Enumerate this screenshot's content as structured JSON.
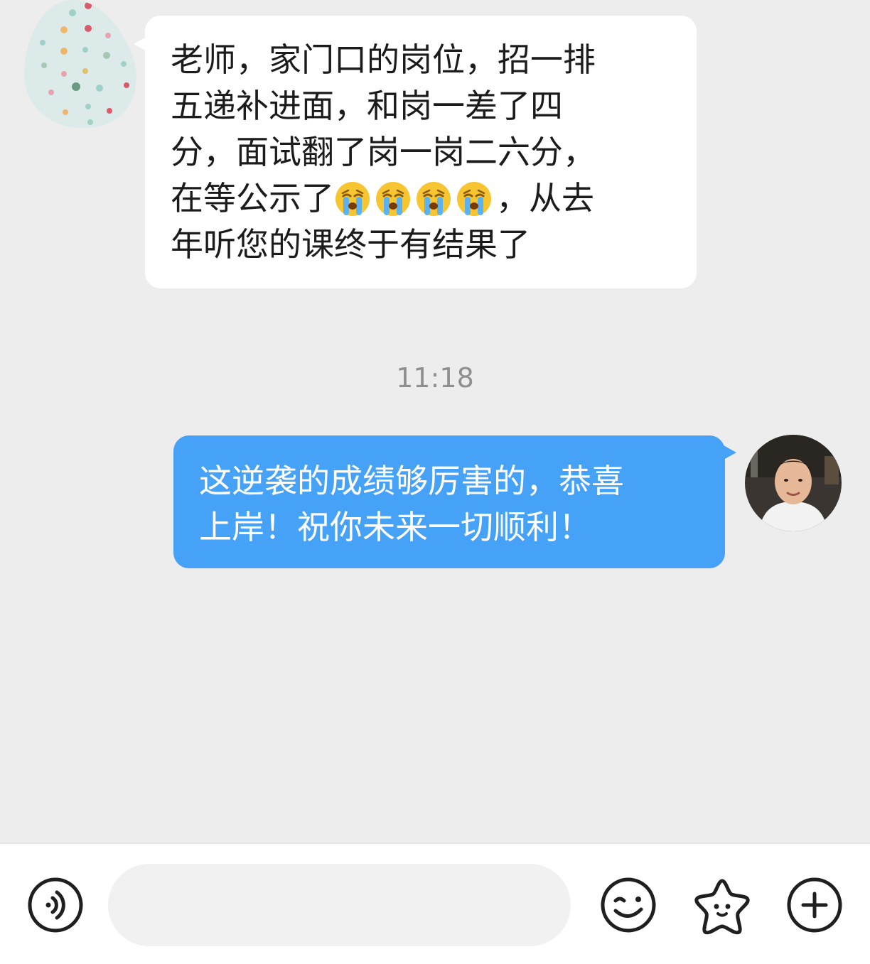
{
  "conversation": {
    "incoming_lines": [
      "老师，家门口的岗位，招一排",
      "五递补进面，和岗一差了四",
      "分，面试翻了岗一岗二六分，",
      "在等公示了",
      "年听您的课终于有结果了"
    ],
    "incoming_line4_suffix": "，从去",
    "incoming_emoji_name": "loudly-crying-face",
    "timestamp": "11:18",
    "outgoing_lines": [
      "这逆袭的成绩够厉害的，恭喜",
      "上岸！祝你未来一切顺利！"
    ]
  },
  "input_bar": {
    "value": "",
    "placeholder": ""
  },
  "colors": {
    "background": "#ededed",
    "outgoing_bubble": "#45a2f7",
    "incoming_bubble": "#ffffff"
  },
  "icons": [
    "voice-icon",
    "emoji-smile-icon",
    "sticker-star-icon",
    "plus-icon"
  ]
}
